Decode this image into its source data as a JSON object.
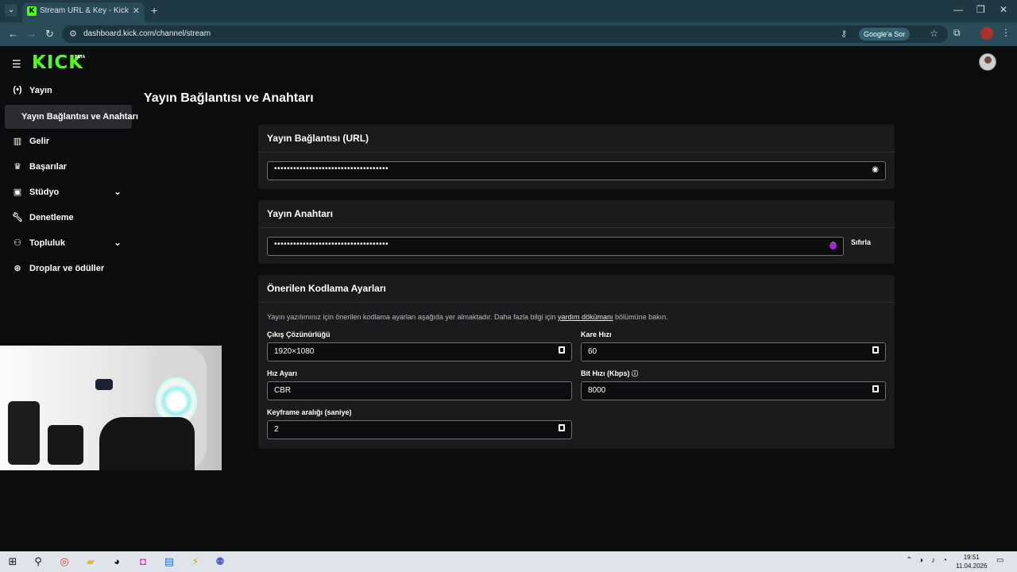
{
  "browser": {
    "tab_title": "Stream URL & Key - Kick Dashb",
    "url": "dashboard.kick.com/channel/stream",
    "google_sor": "Google'a Sor"
  },
  "header": {
    "logo": "KICK",
    "logo_badge": "BETA"
  },
  "sidebar": {
    "items": [
      {
        "label": "Yayın",
        "icon": "broadcast-icon"
      },
      {
        "label": "Yayın Bağlantısı ve Anahtarı",
        "icon": ""
      },
      {
        "label": "Gelir",
        "icon": "chart-icon"
      },
      {
        "label": "Başarılar",
        "icon": "trophy-icon"
      },
      {
        "label": "Stüdyo",
        "icon": "studio-icon"
      },
      {
        "label": "Denetleme",
        "icon": "wrench-icon"
      },
      {
        "label": "Topluluk",
        "icon": "community-icon"
      },
      {
        "label": "Droplar ve ödüller",
        "icon": "drops-icon"
      }
    ]
  },
  "main": {
    "title": "Yayın Bağlantısı ve Anahtarı",
    "url_card": {
      "title": "Yayın Bağlantısı (URL)",
      "value": "••••••••••••••••••••••••••••••••••••"
    },
    "key_card": {
      "title": "Yayın Anahtarı",
      "value": "••••••••••••••••••••••••••••••••••••",
      "reset_label": "Sıfırla"
    },
    "encoding_card": {
      "title": "Önerilen Kodlama Ayarları",
      "desc_before": "Yayın yazılımınız için önerilen kodlama ayarları aşağıda yer almaktadır. Daha fazla bilgi için ",
      "desc_link": "yardım dökümanı",
      "desc_after": " bölümüne bakın.",
      "fields": {
        "resolution": {
          "label": "Çıkış Çözünürlüğü",
          "value": "1920×1080"
        },
        "framerate": {
          "label": "Kare Hızı",
          "value": "60"
        },
        "preset": {
          "label": "Hız Ayarı",
          "value": "CBR"
        },
        "bitrate": {
          "label": "Bit Hızı (Kbps)",
          "value": "8000"
        },
        "keyframe": {
          "label": "Keyframe aralığı (saniye)",
          "value": "2"
        }
      }
    }
  },
  "taskbar": {
    "time": "19:51",
    "date": "11.04.2026"
  }
}
